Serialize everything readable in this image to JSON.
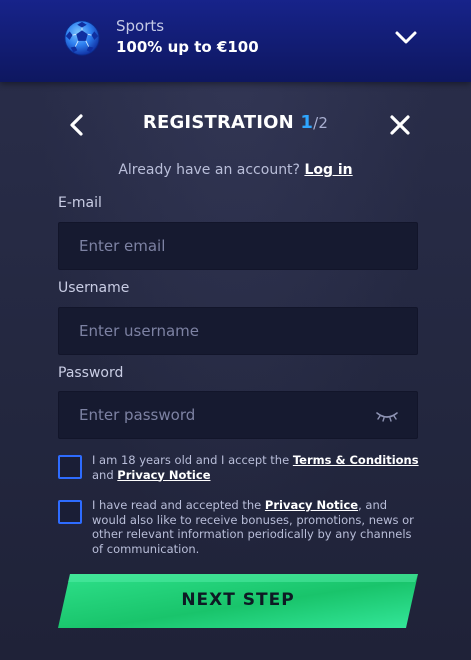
{
  "promo": {
    "category": "Sports",
    "offer": "100% up to €100",
    "icon": "soccer-ball-icon",
    "expand_icon": "chevron-down-icon"
  },
  "header": {
    "title": "REGISTRATION",
    "step_current": "1",
    "step_total": "/2",
    "back_icon": "chevron-left-icon",
    "close_icon": "close-icon"
  },
  "login": {
    "prompt": "Already have an account?",
    "link": "Log in"
  },
  "form": {
    "email": {
      "label": "E-mail",
      "placeholder": "Enter email",
      "value": ""
    },
    "username": {
      "label": "Username",
      "placeholder": "Enter username",
      "value": ""
    },
    "password": {
      "label": "Password",
      "placeholder": "Enter password",
      "value": "",
      "toggle_icon": "eye-closed-icon"
    }
  },
  "consents": {
    "age": {
      "checked": false,
      "text_before": "I am 18 years old and I accept the ",
      "terms_link": "Terms & Conditions",
      "text_mid": " and ",
      "privacy_link": "Privacy Notice"
    },
    "marketing": {
      "checked": false,
      "text_before": "I have read and accepted the ",
      "privacy_link": "Privacy Notice",
      "text_after": ", and would also like to receive bonuses, promotions, news or other relevant information periodically by any channels of communication."
    }
  },
  "actions": {
    "next_label": "NEXT STEP"
  },
  "colors": {
    "promo_bg": "#17238a",
    "accent_blue": "#2fa6ff",
    "checkbox_border": "#2e6cff",
    "button_green": "#21d37a",
    "page_bg": "#262a45",
    "field_bg": "#161a30"
  }
}
